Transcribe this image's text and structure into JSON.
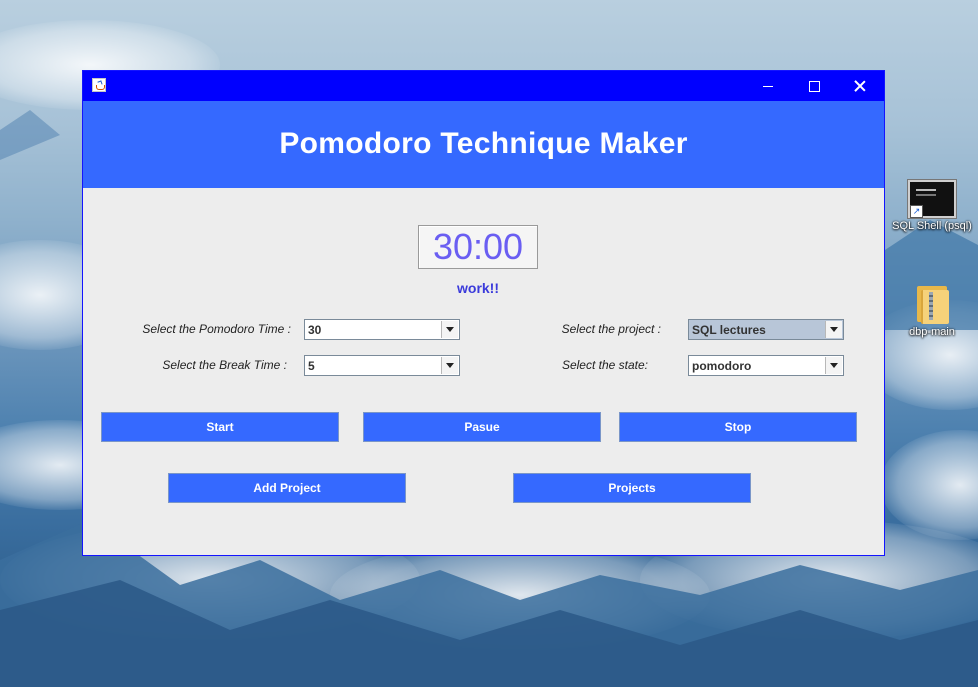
{
  "desktop": {
    "icons": [
      {
        "label": "SQL Shell (psql)",
        "icon": "terminal-icon"
      },
      {
        "label": "dbp-main",
        "icon": "zip-folder-icon"
      }
    ]
  },
  "window": {
    "title": "",
    "controls": [
      "minimize",
      "maximize",
      "close"
    ]
  },
  "app": {
    "title": "Pomodoro Technique Maker",
    "timer": "30:00",
    "state_text": "work!!",
    "fields": {
      "pomodoro_time": {
        "label": "Select the Pomodoro Time :",
        "value": "30"
      },
      "break_time": {
        "label": "Select the Break Time :",
        "value": "5"
      },
      "project": {
        "label": "Select the project :",
        "value": "SQL lectures"
      },
      "state": {
        "label": "Select the state:",
        "value": "pomodoro"
      }
    },
    "buttons": {
      "start": "Start",
      "pause": "Pasue",
      "stop": "Stop",
      "add_project": "Add Project",
      "projects": "Projects"
    }
  },
  "colors": {
    "titlebar": "#0000ff",
    "header": "#3569ff",
    "button": "#3569ff",
    "timer_text": "#6a5ef2",
    "state_text": "#3b3bdb"
  }
}
